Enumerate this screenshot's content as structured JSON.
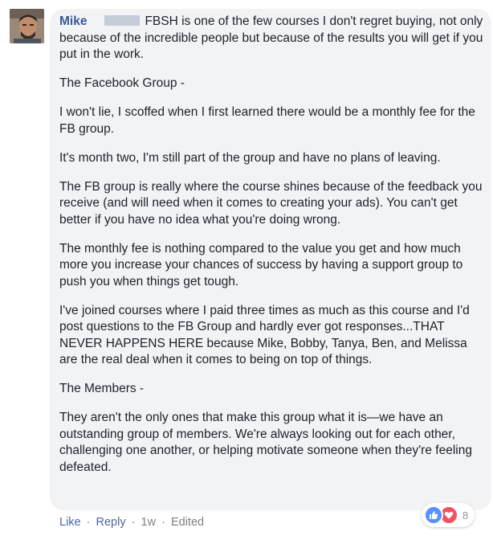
{
  "comment": {
    "author": "Mike",
    "paragraphs": [
      "FBSH is one of the few courses I don't regret buying, not only because of the incredible people but because of the results you will get if you put in the work.",
      "The Facebook Group -",
      "I won't lie, I scoffed when I first learned there would be a monthly fee for the FB group.",
      "It's month two, I'm still part of the group and have no plans of leaving.",
      "The FB group is really where the course shines because of the feedback you receive (and will need when it comes to creating your ads). You can't get better if you have no idea what you're doing wrong.",
      "The monthly fee is nothing compared to the value you get and how much more you increase your chances of success by having a support group to push you when things get tough.",
      "I've joined courses where I paid three times as much as this course and I'd post questions to the FB Group and hardly ever got responses...THAT NEVER HAPPENS HERE because Mike, Bobby, Tanya, Ben, and Melissa are the real deal when it comes to being on top of things.",
      "The Members -",
      "They aren't the only ones that make this group what it is—we have an outstanding group of members. We're always looking out for each other, challenging one another, or helping motivate someone when they're feeling defeated."
    ]
  },
  "actions": {
    "like": "Like",
    "reply": "Reply",
    "separator": "·",
    "time": "1w",
    "edited": "Edited"
  },
  "reactions": {
    "icons": [
      "like-icon",
      "love-icon"
    ],
    "count": "8"
  },
  "colors": {
    "author": "#385898",
    "bubble": "#f2f3f5",
    "like": "#5890ff",
    "love": "#f25268"
  }
}
